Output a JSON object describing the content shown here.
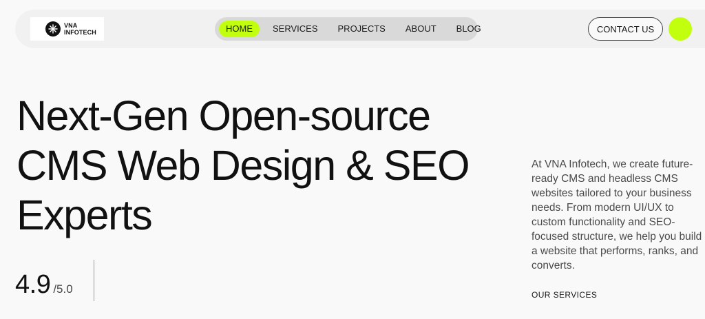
{
  "brand": {
    "logo_line1": "VNA",
    "logo_line2": "INFOTECH",
    "logo_icon": "sunburst-logo-icon"
  },
  "nav": {
    "items": [
      {
        "label": "HOME",
        "active": true
      },
      {
        "label": "SERVICES",
        "active": false
      },
      {
        "label": "PROJECTS",
        "active": false
      },
      {
        "label": "ABOUT",
        "active": false
      },
      {
        "label": "BLOG",
        "active": false
      }
    ]
  },
  "header": {
    "contact_label": "CONTACT US"
  },
  "hero": {
    "title_lines": [
      "Next-Gen Open-source",
      "CMS Web Design & SEO",
      "Experts"
    ],
    "rating_value": "4.9",
    "rating_scale": "/5.0",
    "description": "At VNA Infotech, we create future-ready CMS and headless CMS websites tailored to your business needs. From modern UI/UX to custom functionality and SEO-focused structure, we help you build a website that performs, ranks, and converts.",
    "services_link": "OUR SERVICES"
  },
  "colors": {
    "accent": "#c2ff0f",
    "background": "#f9f9f9",
    "header_bg": "#f1f1f1",
    "nav_bg": "#d9d9d9",
    "text": "#111111"
  }
}
